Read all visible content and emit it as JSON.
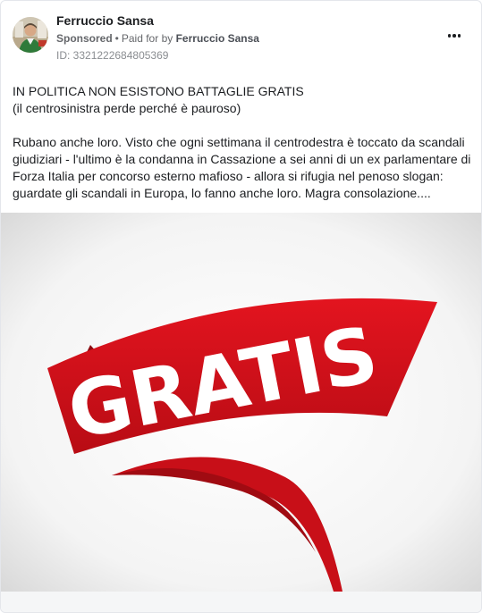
{
  "post": {
    "page_name": "Ferruccio Sansa",
    "sponsored_label": "Sponsored",
    "separator": "•",
    "paid_for_prefix": "Paid for by",
    "paid_for_name": "Ferruccio Sansa",
    "ad_id": "ID: 3321222684805369",
    "more_icon": "more-horizontal-icon",
    "text": {
      "line1": "IN POLITICA NON ESISTONO BATTAGLIE GRATIS",
      "line2": "(il centrosinistra perde perché è pauroso)",
      "paragraph": "Rubano anche loro. Visto che ogni settimana il centrodestra è toccato da scandali giudiziari - l'ultimo è la condanna in Cassazione a sei anni di un ex parlamentare di Forza Italia per concorso esterno mafioso - allora si rifugia nel penoso slogan: guardate gli scandali in Europa, lo fanno anche loro. Magra consolazione...."
    },
    "image": {
      "banner_text": "GRATIS",
      "banner_color": "#d0111b",
      "text_color": "#ffffff"
    }
  }
}
